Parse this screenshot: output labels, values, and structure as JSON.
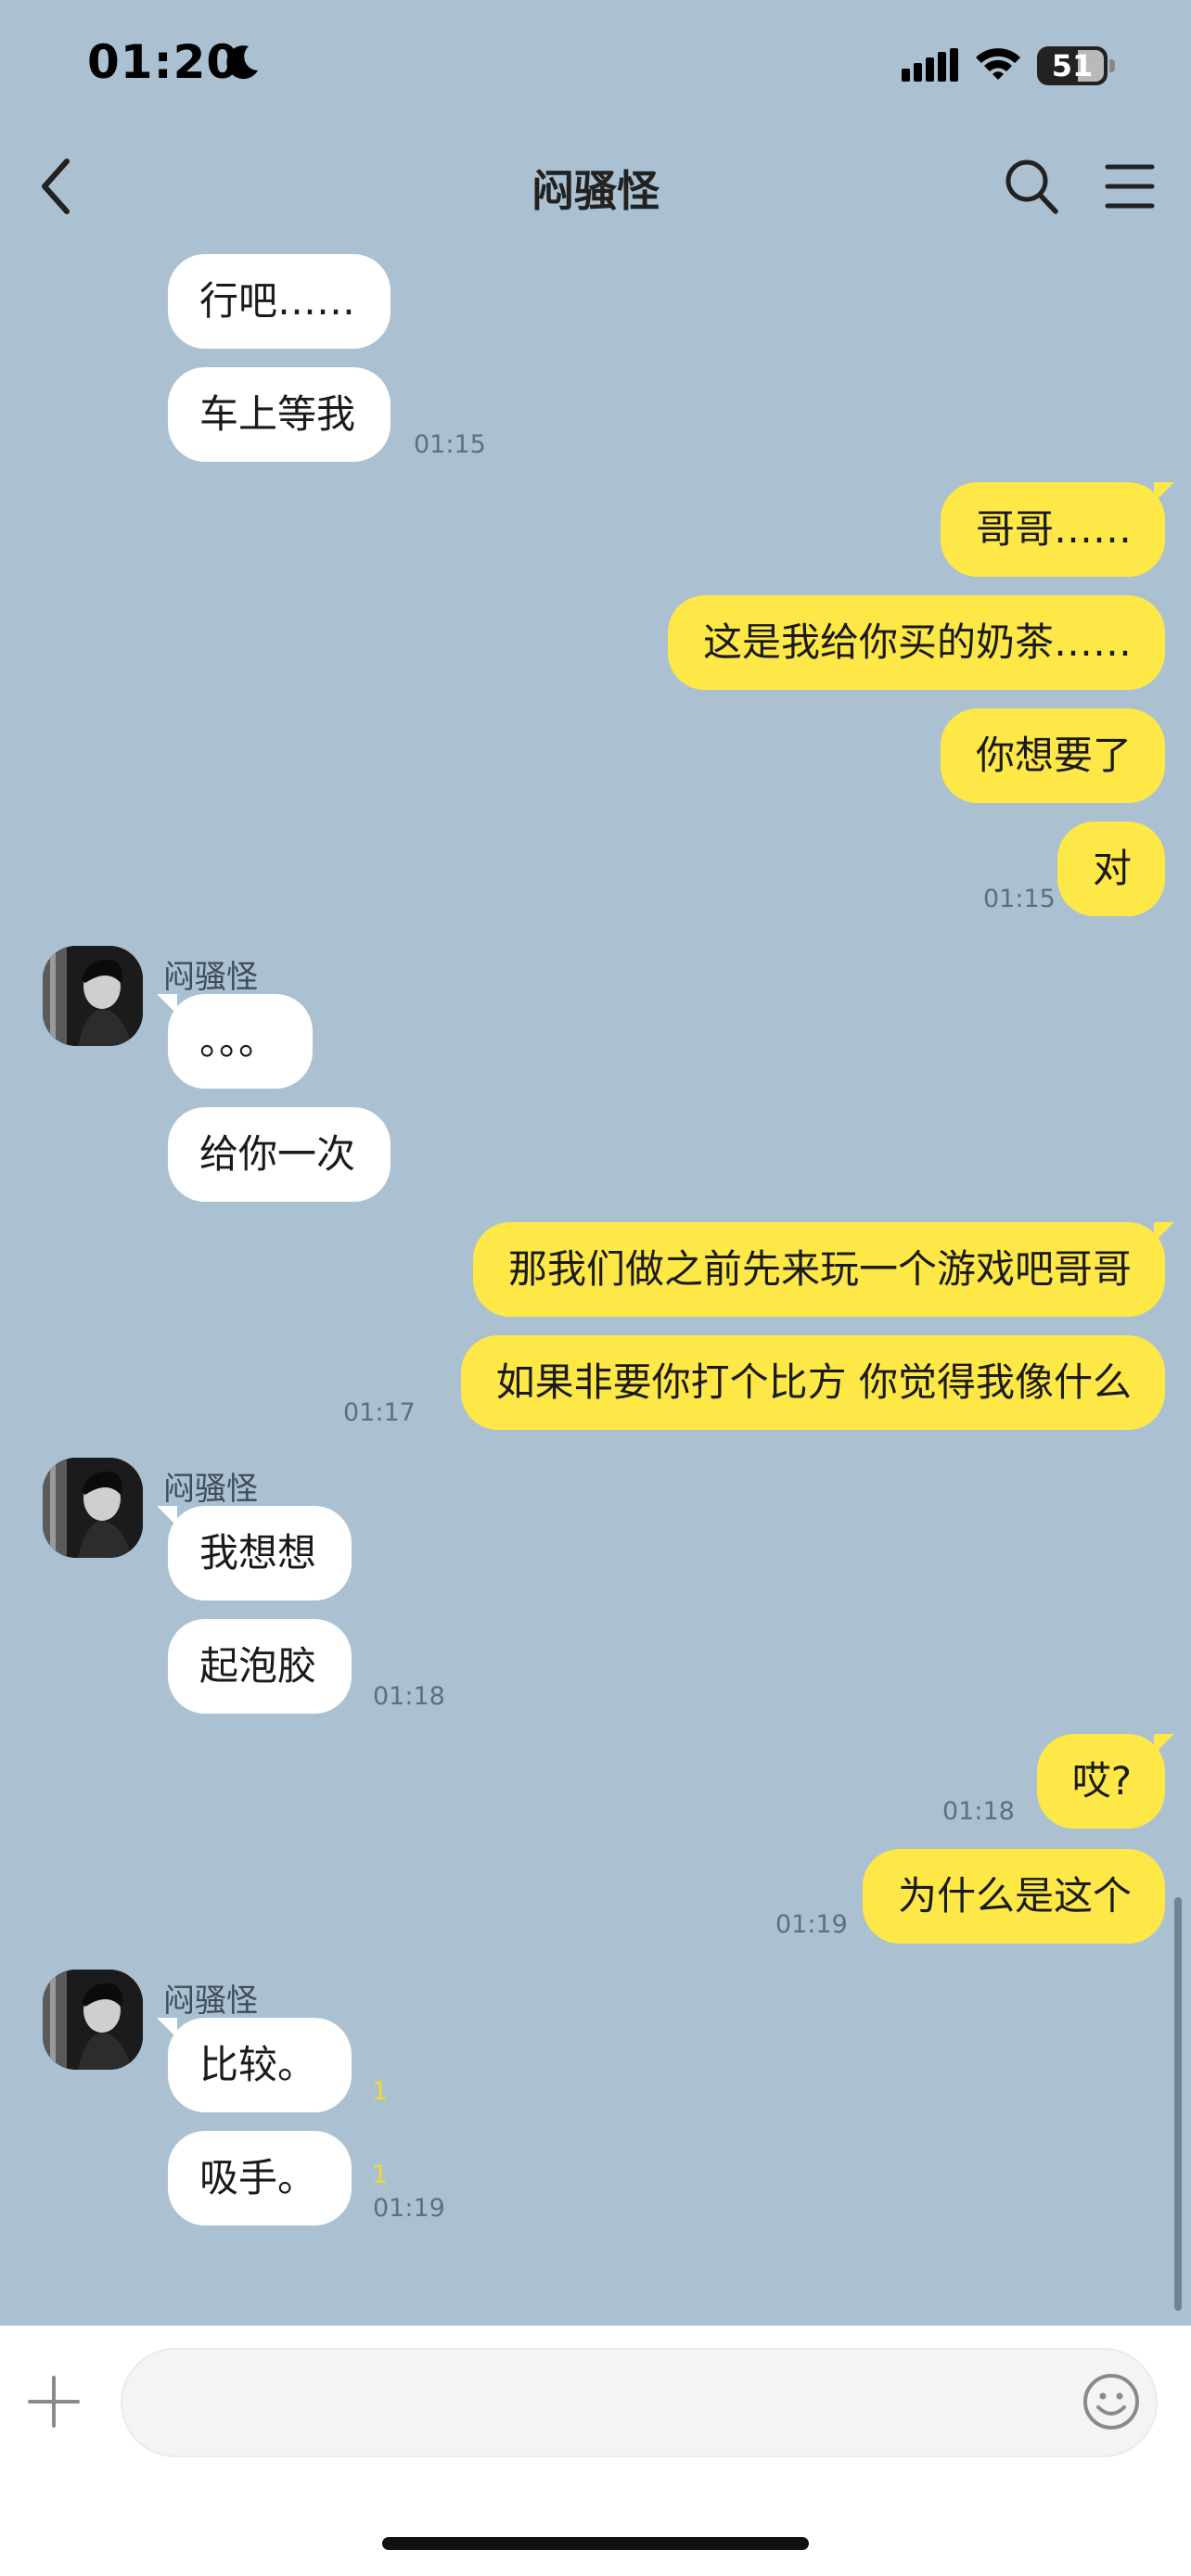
{
  "status_bar": {
    "time": "01:20",
    "battery_level": "51"
  },
  "header": {
    "title": "闷骚怪"
  },
  "sender_name": "闷骚怪",
  "messages": [
    {
      "text": "行吧……"
    },
    {
      "text": "车上等我",
      "time": "01:15"
    },
    {
      "text": "哥哥……"
    },
    {
      "text": "这是我给你买的奶茶……"
    },
    {
      "text": "你想要了"
    },
    {
      "text": "对",
      "time": "01:15"
    },
    {
      "text": "。。。"
    },
    {
      "text": "给你一次"
    },
    {
      "text": "那我们做之前先来玩一个游戏吧哥哥"
    },
    {
      "text": "如果非要你打个比方 你觉得我像什么",
      "time": "01:17"
    },
    {
      "text": "我想想"
    },
    {
      "text": "起泡胶",
      "time": "01:18"
    },
    {
      "text": "哎?",
      "time": "01:18"
    },
    {
      "text": "为什么是这个",
      "time": "01:19"
    },
    {
      "text": "比较。",
      "unread": "1"
    },
    {
      "text": "吸手。",
      "unread": "1",
      "time": "01:19"
    }
  ],
  "colors": {
    "background": "#abc1d1",
    "outgoing_bubble": "#fde848",
    "incoming_bubble": "#ffffff"
  }
}
